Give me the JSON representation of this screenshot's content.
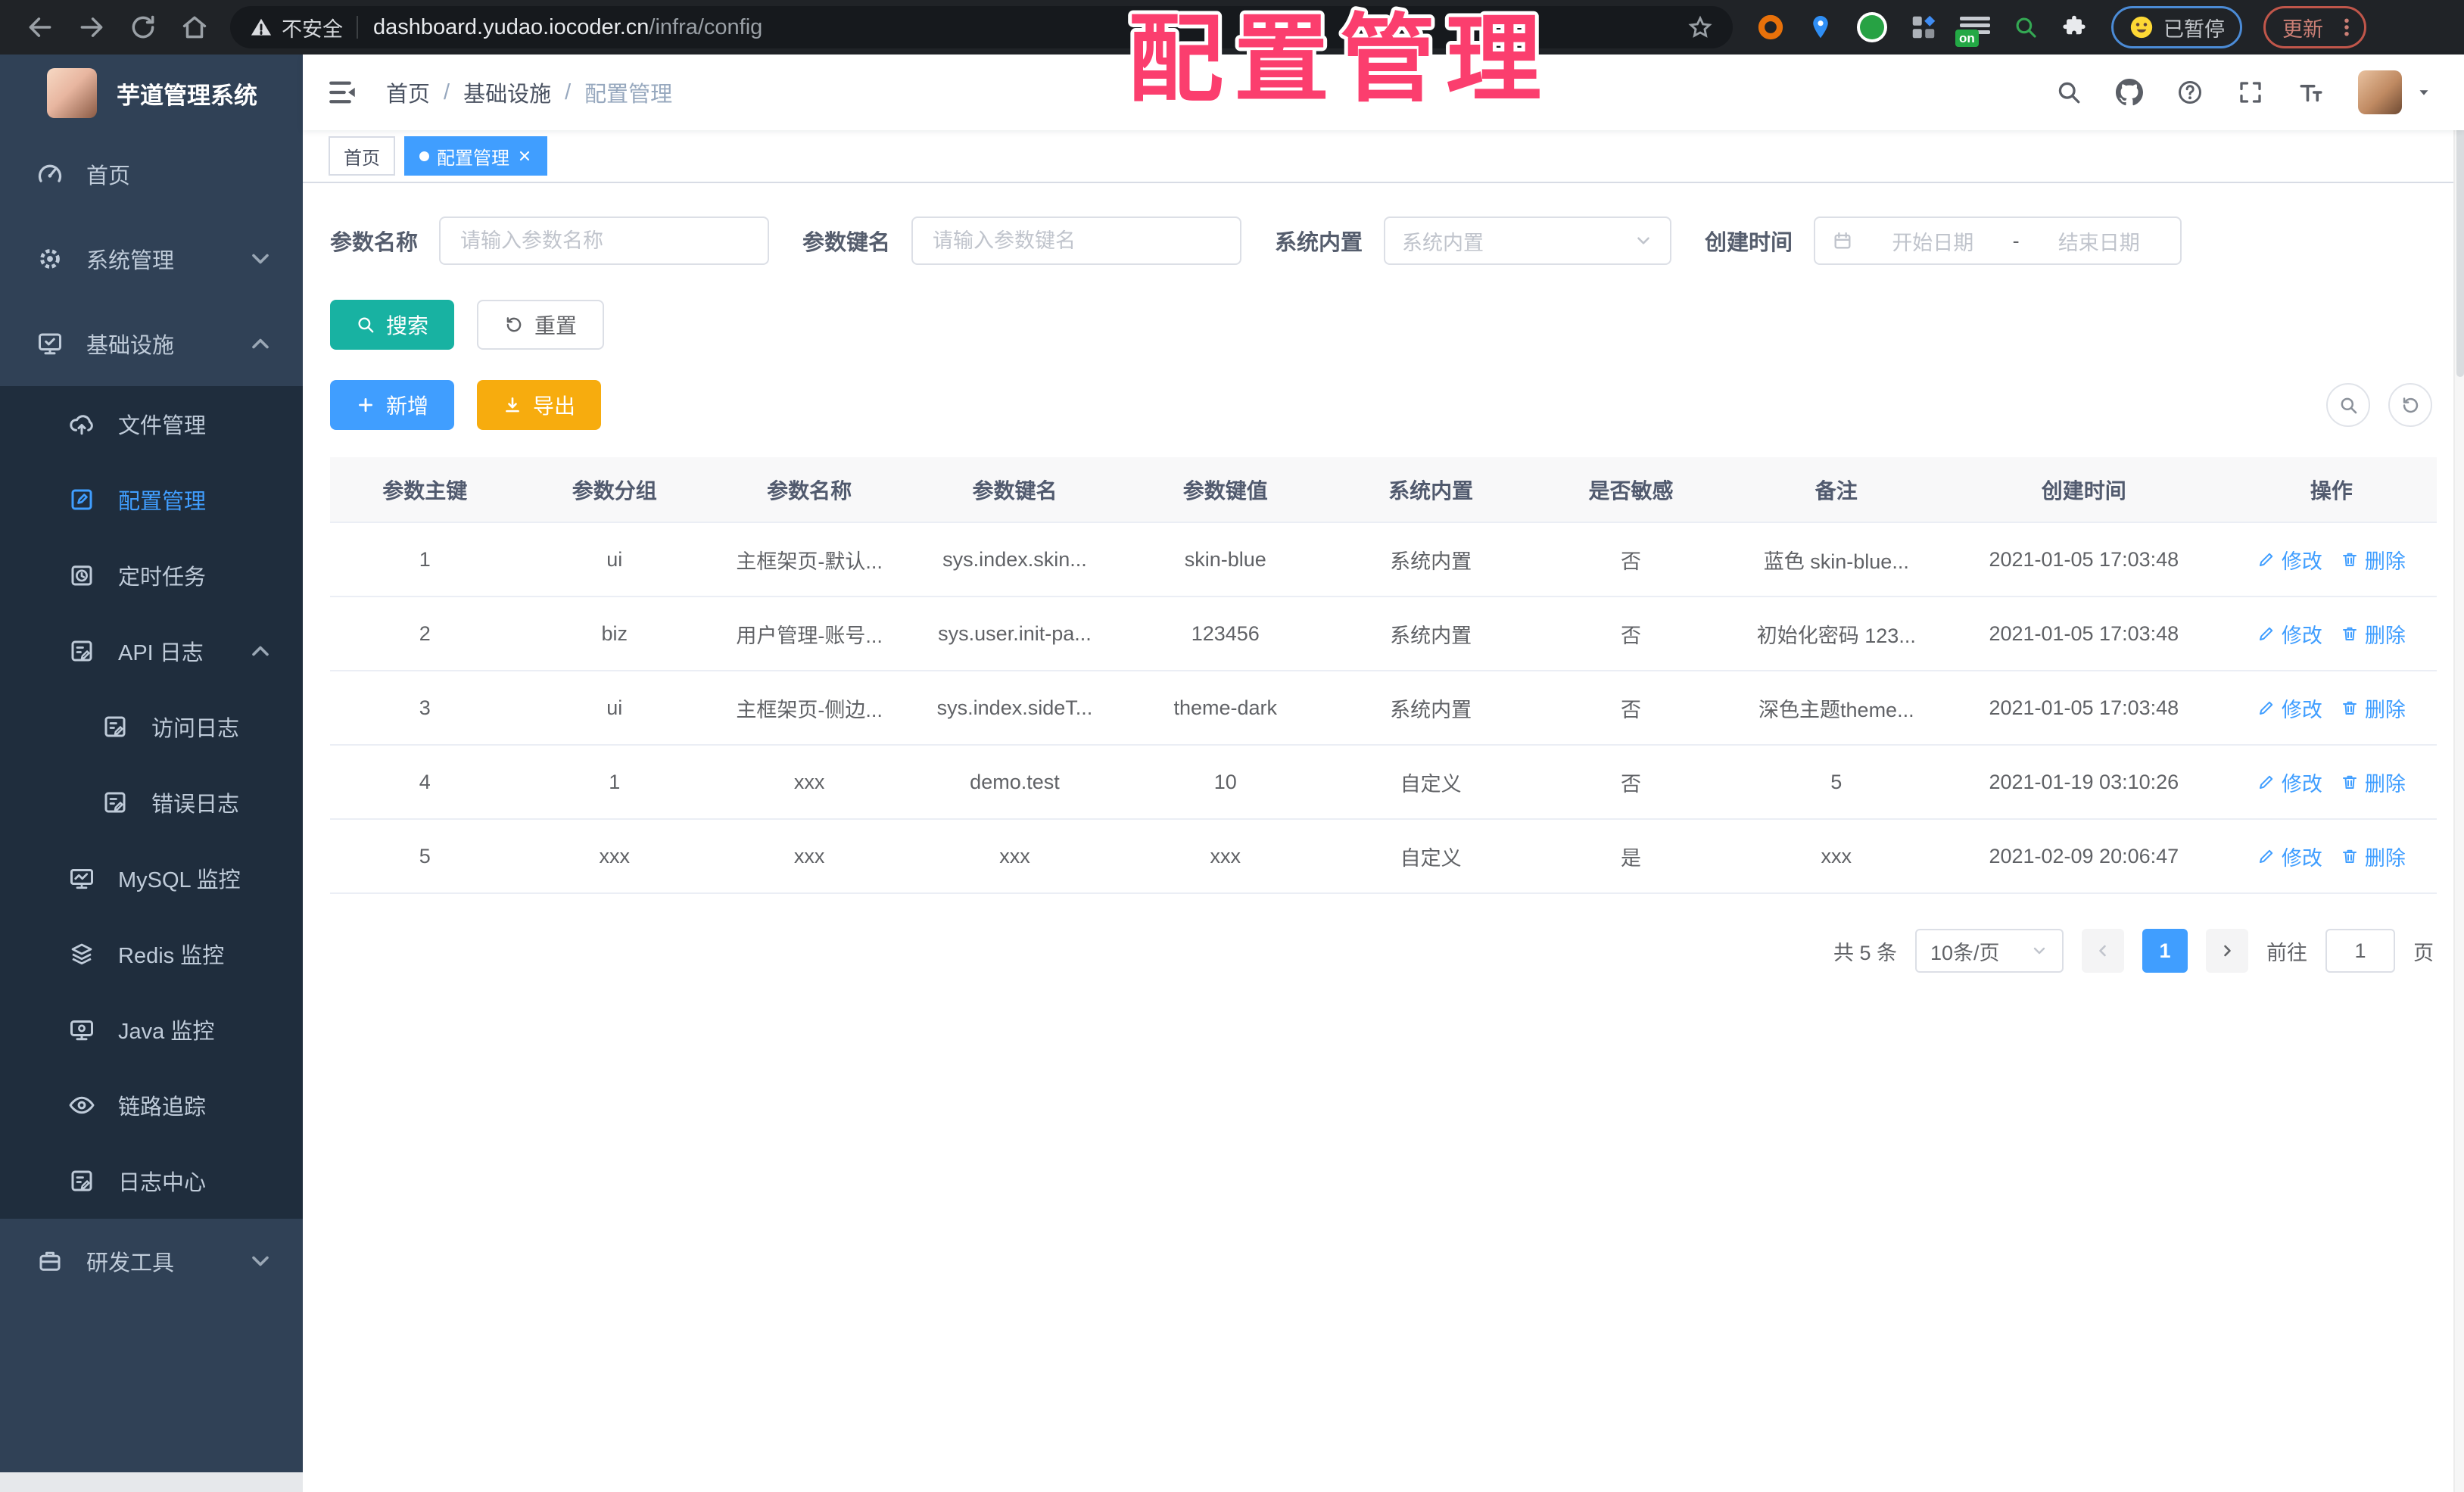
{
  "overlay": {
    "title": "配置管理"
  },
  "browser": {
    "security_label": "不安全",
    "url_host": "dashboard.yudao.iocoder.cn",
    "url_path": "/infra/config",
    "extension_badge": "on",
    "paused_label": "已暂停",
    "update_label": "更新"
  },
  "sidebar": {
    "app_title": "芋道管理系统",
    "items": [
      {
        "id": "home",
        "label": "首页",
        "icon": "dashboard-icon",
        "level": 0
      },
      {
        "id": "system",
        "label": "系统管理",
        "icon": "gear-icon",
        "level": 0,
        "chevron": "down"
      },
      {
        "id": "infra",
        "label": "基础设施",
        "icon": "monitor-check-icon",
        "level": 0,
        "chevron": "up"
      },
      {
        "id": "file",
        "label": "文件管理",
        "icon": "cloud-upload-icon",
        "level": 1,
        "dark": true
      },
      {
        "id": "config",
        "label": "配置管理",
        "icon": "edit-icon",
        "level": 1,
        "dark": true,
        "active": true
      },
      {
        "id": "job",
        "label": "定时任务",
        "icon": "timer-icon",
        "level": 1,
        "dark": true
      },
      {
        "id": "api-log",
        "label": "API 日志",
        "icon": "note-icon",
        "level": 1,
        "dark": true,
        "chevron": "up"
      },
      {
        "id": "access-log",
        "label": "访问日志",
        "icon": "note-icon",
        "level": 2,
        "dark": true
      },
      {
        "id": "error-log",
        "label": "错误日志",
        "icon": "note-icon",
        "level": 2,
        "dark": true
      },
      {
        "id": "mysql",
        "label": "MySQL 监控",
        "icon": "db-monitor-icon",
        "level": 1,
        "dark": true
      },
      {
        "id": "redis",
        "label": "Redis 监控",
        "icon": "layers-icon",
        "level": 1,
        "dark": true
      },
      {
        "id": "java",
        "label": "Java 监控",
        "icon": "screen-icon",
        "level": 1,
        "dark": true
      },
      {
        "id": "trace",
        "label": "链路追踪",
        "icon": "eye-icon",
        "level": 1,
        "dark": true
      },
      {
        "id": "log-center",
        "label": "日志中心",
        "icon": "note-icon",
        "level": 1,
        "dark": true
      },
      {
        "id": "dev-tools",
        "label": "研发工具",
        "icon": "briefcase-icon",
        "level": 0,
        "chevron": "down"
      }
    ]
  },
  "header": {
    "breadcrumb": [
      {
        "label": "首页"
      },
      {
        "label": "基础设施"
      },
      {
        "label": "配置管理"
      }
    ],
    "breadcrumb_separator": "/"
  },
  "tags": {
    "items": [
      {
        "label": "首页",
        "active": false
      },
      {
        "label": "配置管理",
        "active": true
      }
    ]
  },
  "filters": {
    "name_label": "参数名称",
    "name_placeholder": "请输入参数名称",
    "key_label": "参数键名",
    "key_placeholder": "请输入参数键名",
    "builtin_label": "系统内置",
    "builtin_placeholder": "系统内置",
    "created_label": "创建时间",
    "date_start_placeholder": "开始日期",
    "date_separator": "-",
    "date_end_placeholder": "结束日期",
    "search_label": "搜索",
    "reset_label": "重置"
  },
  "toolbar": {
    "add_label": "新增",
    "export_label": "导出"
  },
  "table": {
    "columns": [
      "参数主键",
      "参数分组",
      "参数名称",
      "参数键名",
      "参数键值",
      "系统内置",
      "是否敏感",
      "备注",
      "创建时间",
      "操作"
    ],
    "rows": [
      [
        "1",
        "ui",
        "主框架页-默认...",
        "sys.index.skin...",
        "skin-blue",
        "系统内置",
        "否",
        "蓝色 skin-blue...",
        "2021-01-05 17:03:48"
      ],
      [
        "2",
        "biz",
        "用户管理-账号...",
        "sys.user.init-pa...",
        "123456",
        "系统内置",
        "否",
        "初始化密码 123...",
        "2021-01-05 17:03:48"
      ],
      [
        "3",
        "ui",
        "主框架页-侧边...",
        "sys.index.sideT...",
        "theme-dark",
        "系统内置",
        "否",
        "深色主题theme...",
        "2021-01-05 17:03:48"
      ],
      [
        "4",
        "1",
        "xxx",
        "demo.test",
        "10",
        "自定义",
        "否",
        "5",
        "2021-01-19 03:10:26"
      ],
      [
        "5",
        "xxx",
        "xxx",
        "xxx",
        "xxx",
        "自定义",
        "是",
        "xxx",
        "2021-02-09 20:06:47"
      ]
    ],
    "actions": {
      "edit": "修改",
      "delete": "删除"
    }
  },
  "pagination": {
    "total": "共 5 条",
    "page_size": "10条/页",
    "current_page": "1",
    "goto_label": "前往",
    "goto_value": "1",
    "page_unit": "页"
  },
  "colors": {
    "primary": "#409EFF",
    "sidebar_bg": "#304156",
    "submenu_bg": "#1f2d3d",
    "search_teal": "#18b2a2",
    "export_yellow": "#f7ac0e",
    "overlay_pink": "#fb3e6e"
  }
}
